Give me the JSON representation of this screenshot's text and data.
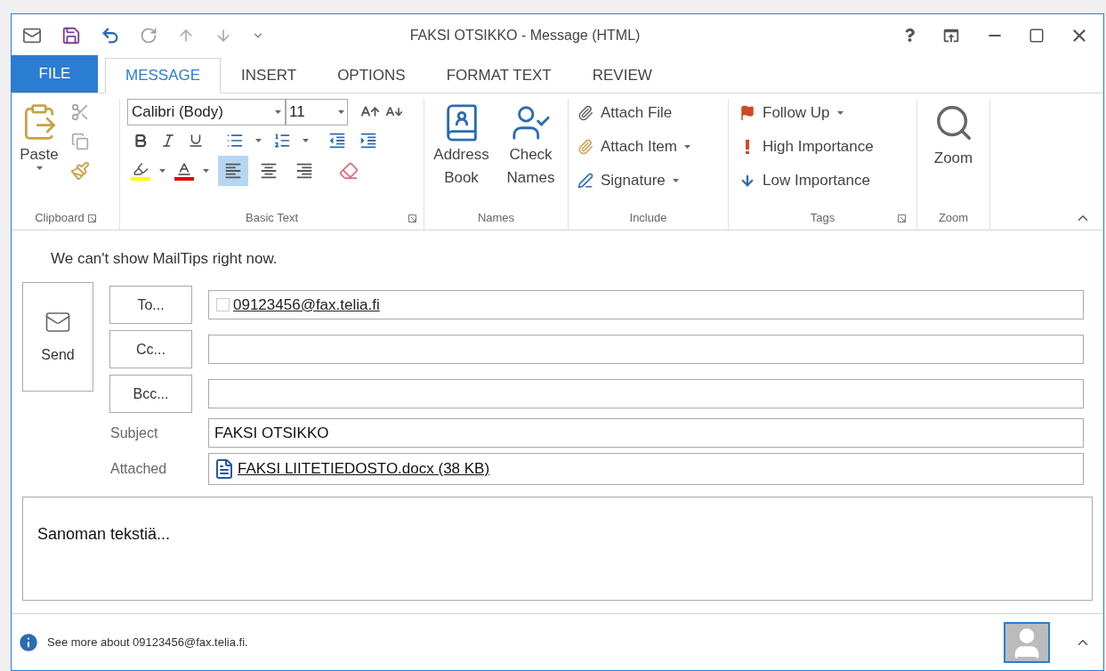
{
  "window": {
    "title": "FAKSI OTSIKKO - Message (HTML)"
  },
  "tabs": [
    {
      "label": "FILE",
      "kind": "file",
      "selected": false
    },
    {
      "label": "MESSAGE",
      "kind": "tab",
      "selected": true
    },
    {
      "label": "INSERT",
      "kind": "tab",
      "selected": false
    },
    {
      "label": "OPTIONS",
      "kind": "tab",
      "selected": false
    },
    {
      "label": "FORMAT TEXT",
      "kind": "tab",
      "selected": false
    },
    {
      "label": "REVIEW",
      "kind": "tab",
      "selected": false
    }
  ],
  "ribbon": {
    "clipboard": {
      "label": "Clipboard",
      "paste": "Paste"
    },
    "basic_text": {
      "label": "Basic Text",
      "font": "Calibri (Body)",
      "size": "11",
      "alignment": [
        {
          "kind": "left",
          "selected": true
        },
        {
          "kind": "center",
          "selected": false
        },
        {
          "kind": "right",
          "selected": false
        }
      ]
    },
    "names": {
      "label": "Names",
      "buttons": [
        {
          "kind": "address",
          "label": "Address Book"
        },
        {
          "kind": "check",
          "label": "Check Names"
        }
      ]
    },
    "include": {
      "label": "Include",
      "items": [
        {
          "kind": "file",
          "label": "Attach File",
          "dropdown": false
        },
        {
          "kind": "item",
          "label": "Attach Item",
          "dropdown": true
        },
        {
          "kind": "signature",
          "label": "Signature",
          "dropdown": true
        }
      ]
    },
    "tags": {
      "label": "Tags",
      "items": [
        {
          "kind": "flag",
          "label": "Follow Up",
          "dropdown": true
        },
        {
          "kind": "high",
          "label": "High Importance",
          "dropdown": false
        },
        {
          "kind": "low",
          "label": "Low Importance",
          "dropdown": false
        }
      ]
    },
    "zoom": {
      "label": "Zoom",
      "button": "Zoom"
    }
  },
  "mailtips": "We can't show MailTips right now.",
  "send": "Send",
  "recipients": [
    {
      "button": "To...",
      "value": "09123456@fax.telia.fi"
    },
    {
      "button": "Cc..."
    },
    {
      "button": "Bcc..."
    }
  ],
  "subject": {
    "label": "Subject",
    "value": "FAKSI OTSIKKO"
  },
  "attached": {
    "label": "Attached",
    "file": "FAKSI LIITETIEDOSTO.docx (38 KB)"
  },
  "body": "Sanoman tekstiä...",
  "footer": "See more about 09123456@fax.telia.fi."
}
